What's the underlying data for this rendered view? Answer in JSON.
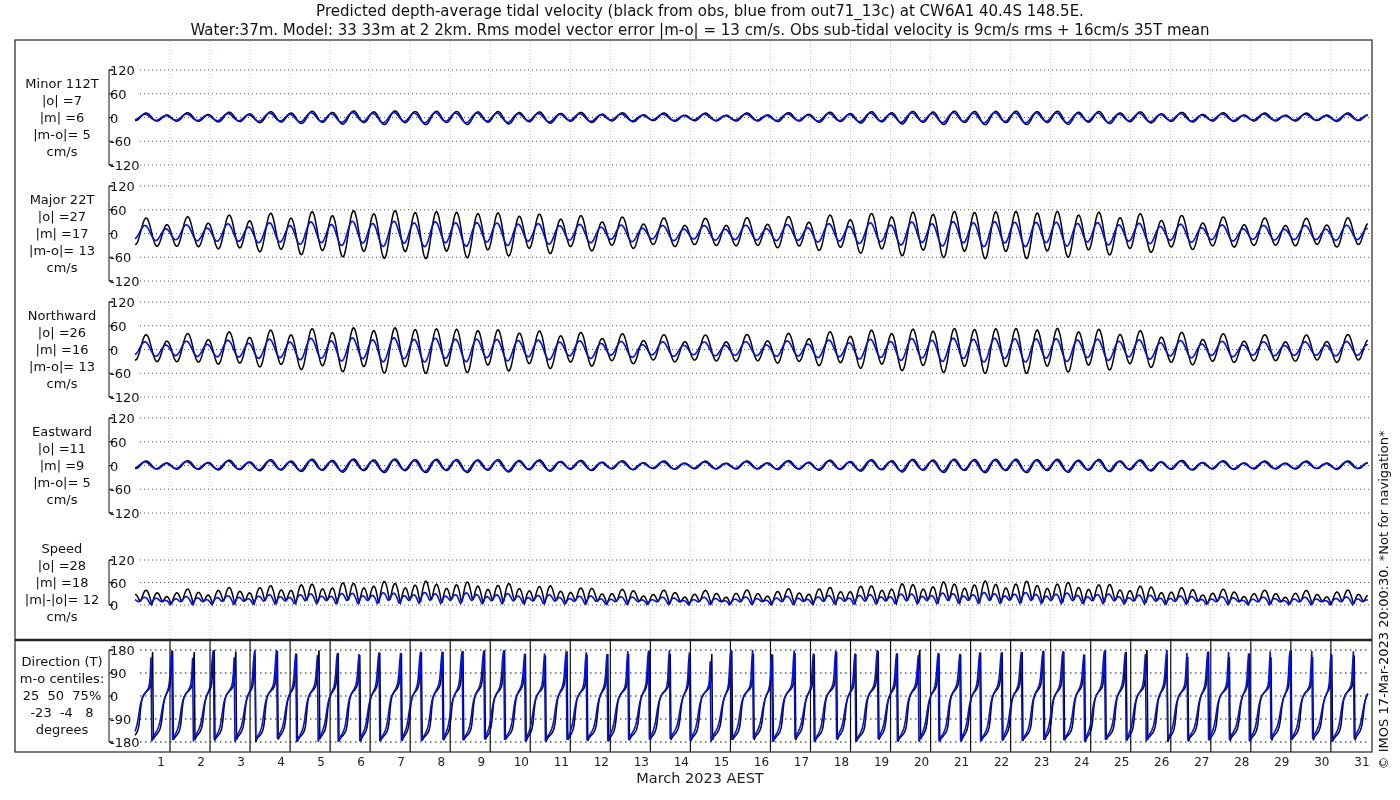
{
  "title": [
    "Predicted depth-average tidal velocity (black from obs, blue from out71_13c) at CW6A1 40.4S 148.5E.",
    "Water:37m. Model: 33 33m at 2 2km. Rms model vector error |m-o| = 13 cm/s. Obs sub-tidal velocity is 9cm/s rms + 16cm/s 35T mean"
  ],
  "panels": [
    {
      "kind": "velocity",
      "label": [
        "Minor 112T",
        "|o| =7",
        "|m| =6",
        "|m-o|= 5",
        "cm/s"
      ],
      "yticks": [
        "120",
        "60",
        "0",
        "-60",
        "-120"
      ]
    },
    {
      "kind": "velocity",
      "label": [
        "Major 22T",
        "|o| =27",
        "|m| =17",
        "|m-o|= 13",
        "cm/s"
      ],
      "yticks": [
        "120",
        "60",
        "0",
        "-60",
        "-120"
      ]
    },
    {
      "kind": "velocity",
      "label": [
        "Northward",
        "|o| =26",
        "|m| =16",
        "|m-o|= 13",
        "cm/s"
      ],
      "yticks": [
        "120",
        "60",
        "0",
        "-60",
        "-120"
      ]
    },
    {
      "kind": "velocity",
      "label": [
        "Eastward",
        "|o| =11",
        "|m| =9",
        "|m-o|= 5",
        "cm/s"
      ],
      "yticks": [
        "120",
        "60",
        "0",
        "-60",
        "-120"
      ]
    },
    {
      "kind": "speed",
      "label": [
        "Speed",
        "|o| =28",
        "|m| =18",
        "|m|-|o|= 12",
        "cm/s"
      ],
      "yticks": [
        "120",
        "60",
        "0"
      ]
    },
    {
      "kind": "direction",
      "label": [
        "Direction (T)",
        "m-o centiles:",
        "25  50  75%",
        "-23  -4   8",
        "degrees"
      ],
      "yticks": [
        "180",
        "90",
        "0",
        "-90",
        "-180"
      ]
    }
  ],
  "xticks": [
    "1",
    "2",
    "3",
    "4",
    "5",
    "6",
    "7",
    "8",
    "9",
    "10",
    "11",
    "12",
    "13",
    "14",
    "15",
    "16",
    "17",
    "18",
    "19",
    "20",
    "21",
    "22",
    "23",
    "24",
    "25",
    "26",
    "27",
    "28",
    "29",
    "30",
    "31"
  ],
  "xlabel": "March 2023 AEST",
  "credit": "© IMOS 17-Mar-2023 20:00:30. *Not for navigation*"
}
